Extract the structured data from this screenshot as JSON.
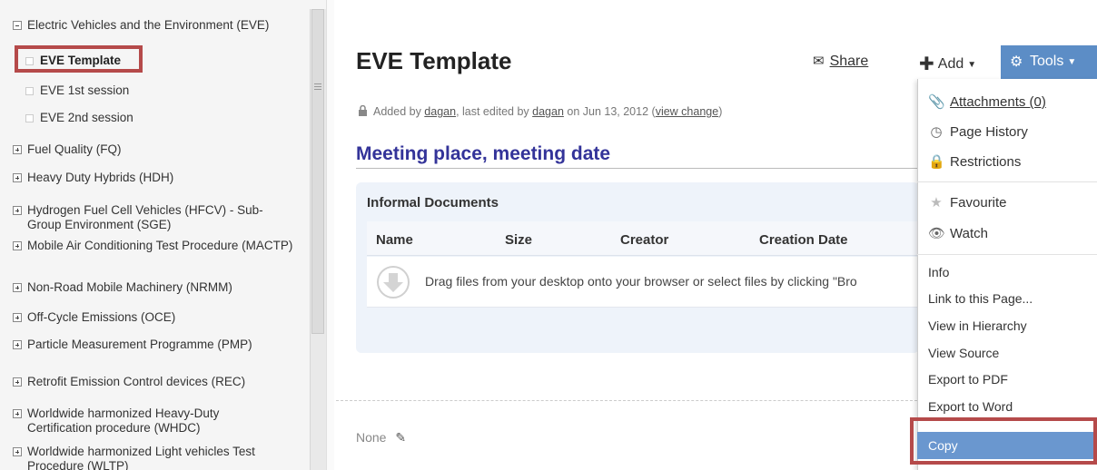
{
  "sidebar": {
    "items": [
      {
        "label": "Electric Vehicles and the Environment (EVE)",
        "type": "minus"
      },
      {
        "label": "EVE Template",
        "type": "leaf",
        "selected": true
      },
      {
        "label": "EVE 1st session",
        "type": "leaf"
      },
      {
        "label": "EVE 2nd session",
        "type": "leaf"
      },
      {
        "label": "Fuel Quality (FQ)",
        "type": "plus"
      },
      {
        "label": "Heavy Duty Hybrids (HDH)",
        "type": "plus"
      },
      {
        "label": "Hydrogen Fuel Cell Vehicles (HFCV) - Sub-Group Environment (SGE)",
        "type": "plus"
      },
      {
        "label": "Mobile Air Conditioning Test Procedure (MACTP)",
        "type": "plus"
      },
      {
        "label": "Non-Road Mobile Machinery (NRMM)",
        "type": "plus"
      },
      {
        "label": "Off-Cycle Emissions (OCE)",
        "type": "plus"
      },
      {
        "label": "Particle Measurement Programme (PMP)",
        "type": "plus"
      },
      {
        "label": "Retrofit Emission Control devices (REC)",
        "type": "plus"
      },
      {
        "label": "Worldwide harmonized Heavy-Duty Certification procedure (WHDC)",
        "type": "plus"
      },
      {
        "label": "Worldwide harmonized Light vehicles Test Procedure (WLTP)",
        "type": "plus"
      }
    ]
  },
  "page": {
    "title": "EVE Template",
    "share_label": "Share",
    "add_label": "Add",
    "tools_label": "Tools",
    "meta": {
      "added_by": "Added by ",
      "author": "dagan",
      "edited": ", last edited by ",
      "editor": "dagan",
      "on": " on Jun 13, 2012 ",
      "view_change": "view change"
    },
    "heading": "Meeting place, meeting date",
    "panel_title": "Informal Documents",
    "columns": [
      "Name",
      "Size",
      "Creator",
      "Creation Date"
    ],
    "drop_text": "Drag files from your desktop onto your browser or select files by clicking \"Bro",
    "none_label": "None"
  },
  "menu": {
    "attachments": "Attachments (0)",
    "page_history": "Page History",
    "restrictions": "Restrictions",
    "favourite": "Favourite",
    "watch": "Watch",
    "info": "Info",
    "link": "Link to this Page...",
    "hierarchy": "View in Hierarchy",
    "source": "View Source",
    "pdf": "Export to PDF",
    "word": "Export to Word",
    "copy": "Copy"
  },
  "colors": {
    "tools_bg": "#5c8dc6",
    "heading": "#333399",
    "highlight": "#b54a4a"
  }
}
